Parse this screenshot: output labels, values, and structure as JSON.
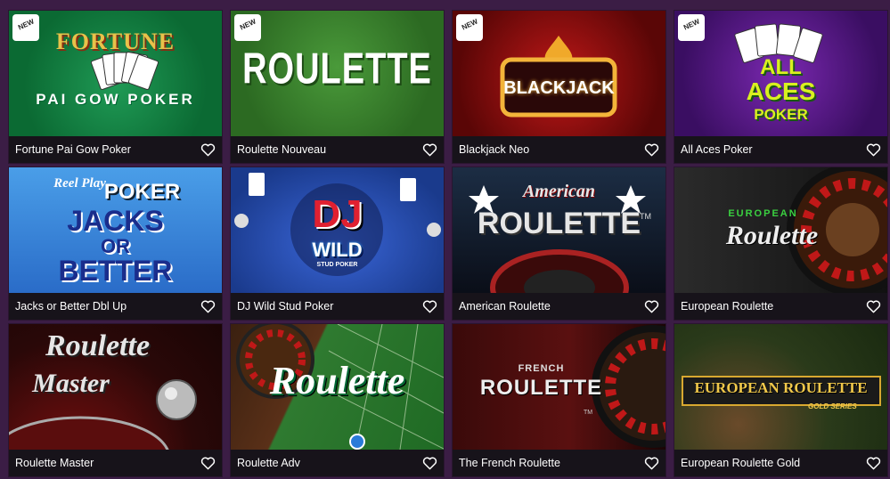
{
  "games": [
    {
      "title": "Fortune Pai Gow Poker",
      "new": true,
      "art": {
        "line1": "FORTUNE",
        "line2": "PAI GOW POKER"
      }
    },
    {
      "title": "Roulette Nouveau",
      "new": true,
      "art": {
        "line1": "ROULETTE"
      }
    },
    {
      "title": "Blackjack Neo",
      "new": true,
      "art": {
        "line1": "BLACKJACK"
      }
    },
    {
      "title": "All Aces Poker",
      "new": true,
      "art": {
        "line1": "ALL",
        "line2": "ACES",
        "line3": "POKER"
      }
    },
    {
      "title": "Jacks or Better Dbl Up",
      "new": false,
      "art": {
        "line1": "Reel Play",
        "line2": "POKER",
        "line3": "JACKS",
        "line4": "OR",
        "line5": "BETTER"
      }
    },
    {
      "title": "DJ Wild Stud Poker",
      "new": false,
      "art": {
        "line1": "DJ",
        "line2": "WILD",
        "line3": "STUD POKER"
      }
    },
    {
      "title": "American Roulette",
      "new": false,
      "art": {
        "line1": "American",
        "line2": "ROULETTE",
        "line3": "TM"
      }
    },
    {
      "title": "European Roulette",
      "new": false,
      "art": {
        "line1": "EUROPEAN",
        "line2": "Roulette"
      }
    },
    {
      "title": "Roulette Master",
      "new": false,
      "art": {
        "line1": "Roulette",
        "line2": "Master"
      }
    },
    {
      "title": "Roulette Adv",
      "new": false,
      "art": {
        "line1": "Roulette"
      }
    },
    {
      "title": "The French Roulette",
      "new": false,
      "art": {
        "line1": "FRENCH",
        "line2": "ROULETTE",
        "line3": "TM"
      }
    },
    {
      "title": "European Roulette Gold",
      "new": false,
      "art": {
        "line1": "EUROPEAN ROULETTE",
        "line2": "GOLD SERIES"
      }
    }
  ],
  "badge_label": "NEW",
  "icons": {
    "favorite": "heart-outline-icon"
  },
  "colors": {
    "page_bg": "#3b1d45",
    "bar_bg": "#17131a",
    "text": "#ffffff"
  }
}
